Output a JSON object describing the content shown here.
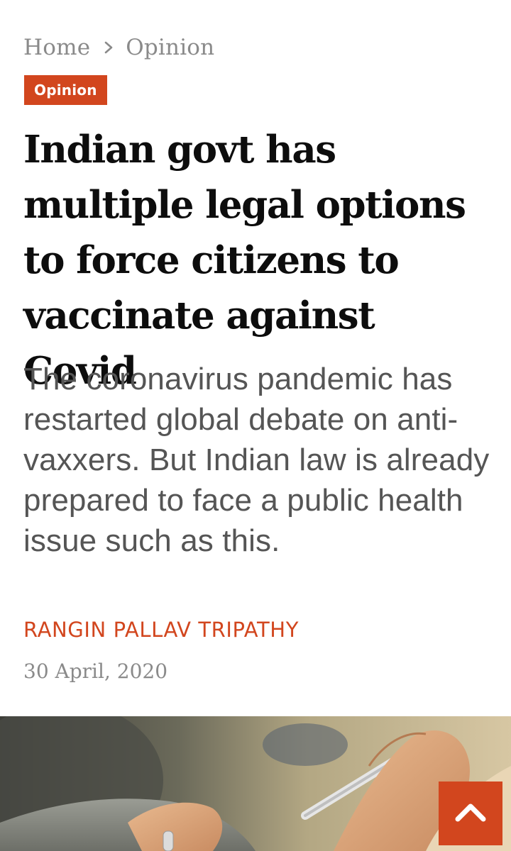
{
  "breadcrumb": {
    "home": "Home",
    "current": "Opinion"
  },
  "article": {
    "category": "Opinion",
    "headline": "Indian govt has multiple legal options to force citizens to vaccinate against Covid",
    "standfirst": "The coronavirus pandemic has restarted global debate on anti-vaxxers. But Indian law is already prepared to face a public health issue such as this.",
    "author": "RANGIN PALLAV TRIPATHY",
    "date": "30 April, 2020"
  },
  "icons": {
    "breadcrumb_separator": "chevron-right-icon",
    "scroll_top": "chevron-up-icon"
  },
  "colors": {
    "accent": "#d2461e",
    "headline": "#0d0d0d",
    "muted": "#8a8a8a",
    "standfirst": "#555555"
  }
}
